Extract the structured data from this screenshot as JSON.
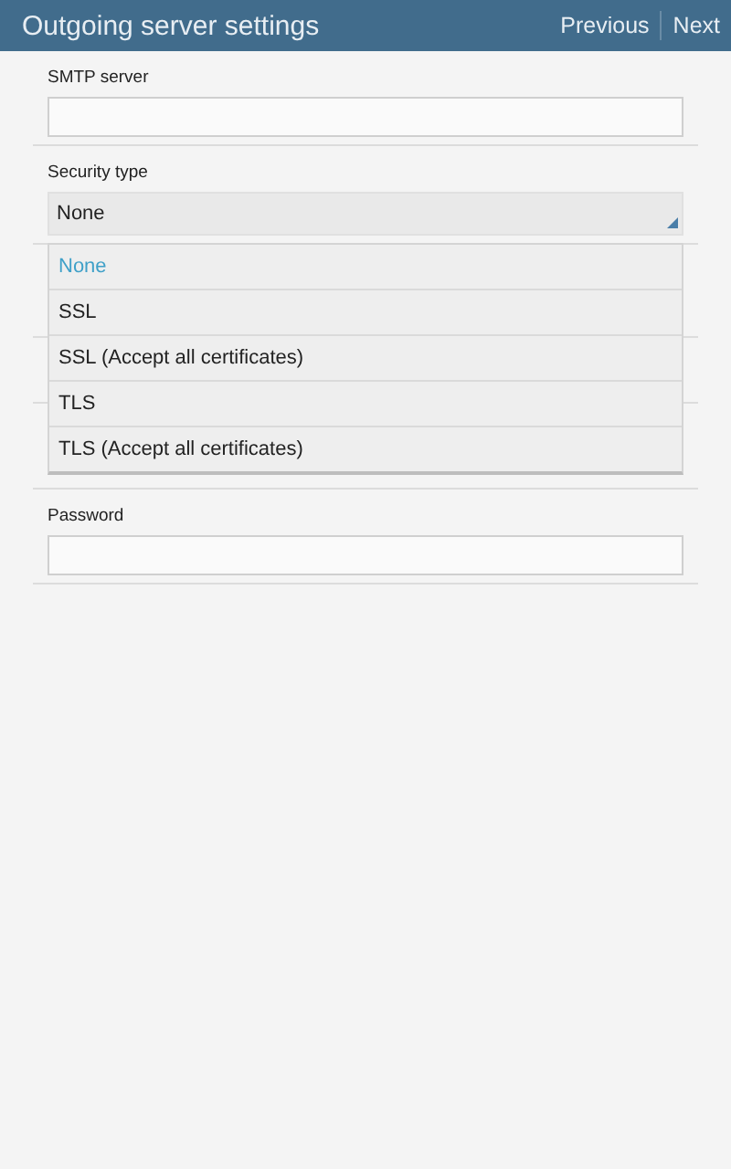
{
  "header": {
    "title": "Outgoing server settings",
    "actions": [
      "Previous",
      "Next"
    ]
  },
  "smtp": {
    "label": "SMTP server"
  },
  "security": {
    "label": "Security type",
    "value": "None",
    "expanded": true,
    "options": [
      {
        "label": "None",
        "selected": true
      },
      {
        "label": "SSL",
        "selected": false
      },
      {
        "label": "SSL (Accept all certificates)",
        "selected": false
      },
      {
        "label": "TLS",
        "selected": false
      },
      {
        "label": "TLS (Accept all certificates)",
        "selected": false
      }
    ]
  },
  "password": {
    "label": "Password"
  }
}
